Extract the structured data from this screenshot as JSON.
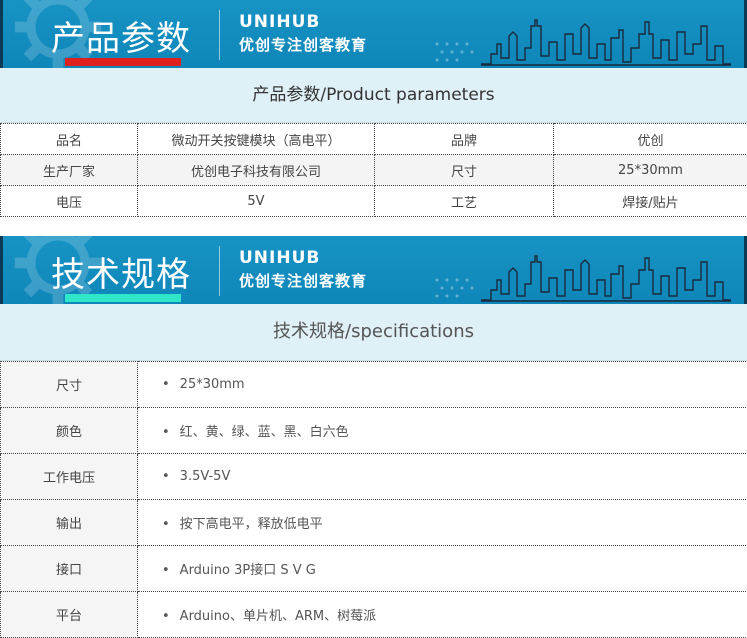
{
  "colors": {
    "banner_blue": "#1590c2",
    "accent_red": "#e0201f",
    "accent_teal": "#2ee6c8",
    "section_bg": "#dff0f6"
  },
  "banner1": {
    "title": "产品参数",
    "brand": "UNIHUB",
    "slogan": "优创专注创客教育"
  },
  "section1": {
    "title": "产品参数/Product parameters",
    "rows": [
      {
        "k1": "品名",
        "v1": "微动开关按键模块（高电平）",
        "k2": "品牌",
        "v2": "优创"
      },
      {
        "k1": "生产厂家",
        "v1": "优创电子科技有限公司",
        "k2": "尺寸",
        "v2": "25*30mm"
      },
      {
        "k1": "电压",
        "v1": "5V",
        "k2": "工艺",
        "v2": "焊接/贴片"
      }
    ]
  },
  "banner2": {
    "title": "技术规格",
    "brand": "UNIHUB",
    "slogan": "优创专注创客教育"
  },
  "section2": {
    "title": "技术规格/specifications",
    "rows": [
      {
        "label": "尺寸",
        "value": "25*30mm"
      },
      {
        "label": "颜色",
        "value": "红、黄、绿、蓝、黑、白六色"
      },
      {
        "label": "工作电压",
        "value": "3.5V-5V"
      },
      {
        "label": "输出",
        "value": "按下高电平，释放低电平"
      },
      {
        "label": "接口",
        "value": "Arduino 3P接口 S V G"
      },
      {
        "label": "平台",
        "value": "Arduino、单片机、ARM、树莓派"
      }
    ]
  }
}
